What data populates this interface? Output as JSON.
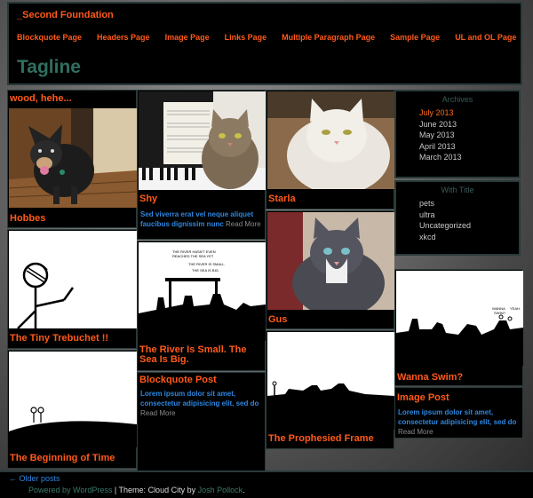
{
  "site": {
    "title": "_Second Foundation",
    "tagline": "Tagline"
  },
  "nav": [
    "Blockquote Page",
    "Headers Page",
    "Image Page",
    "Links Page",
    "Multiple Paragraph Page",
    "Sample Page",
    "UL and OL Page"
  ],
  "posts": {
    "wood": {
      "title": "wood, hehe..."
    },
    "hobbes": {
      "title": "Hobbes"
    },
    "trebuchet": {
      "title": "The Tiny Trebuchet !!"
    },
    "beginning": {
      "title": "The Beginning of Time"
    },
    "shy": {
      "title": "Shy",
      "excerpt": "Sed viverra erat vel neque aliquet faucibus dignissim nunc",
      "more": "Read More"
    },
    "river": {
      "title": "The River Is Small. The Sea Is Big.",
      "comic_lines": [
        "THE RIVER HASN'T EVEN",
        "REACHED THE SEA YET",
        "THE RIVER IS SMALL.",
        "THE SEA IS BIG."
      ]
    },
    "blockquote": {
      "title": "Blockquote Post",
      "excerpt": "Lorem ipsum dolor sit amet, consectetur adipisicing elit, sed do",
      "more": "Read More"
    },
    "starla": {
      "title": "Starla"
    },
    "gus": {
      "title": "Gus"
    },
    "prophesied": {
      "title": "The Prophesied Frame"
    },
    "swim": {
      "title": "Wanna Swim?",
      "comic_text": [
        "WANNA",
        "SWIM?",
        "YEAH."
      ]
    },
    "imagepost": {
      "title": "Image Post",
      "excerpt": "Lorem ipsum dolor sit amet, consectetur adipisicing elit, sed do",
      "more": "Read More"
    }
  },
  "sidebar": {
    "archives_title": "Archives",
    "archives": [
      "July 2013",
      "June 2013",
      "May 2013",
      "April 2013",
      "March 2013"
    ],
    "with_title": "With Title",
    "categories": [
      "pets",
      "ultra",
      "Uncategorized",
      "xkcd"
    ]
  },
  "footer": {
    "older": "← Older posts",
    "powered_prefix": "Powered by WordPress",
    "separator": " | Theme: Cloud City by ",
    "author": "Josh Pollock",
    "end": "."
  },
  "colors": {
    "accent": "#ff5a1a",
    "link": "#2e86de",
    "tagline": "#2f6f5f"
  }
}
